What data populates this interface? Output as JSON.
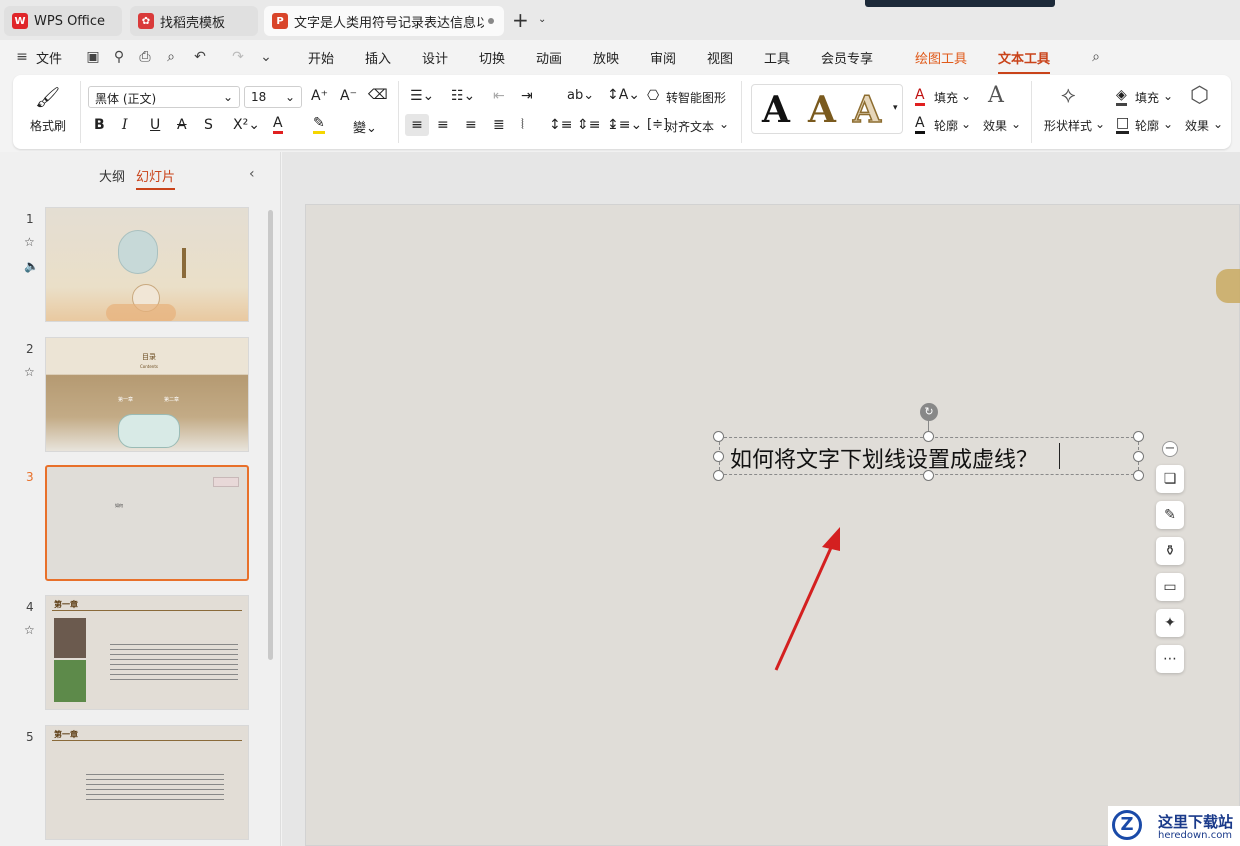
{
  "tabs": {
    "wps": "WPS Office",
    "template": "找稻壳模板",
    "document": "文字是人类用符号记录表达信息以"
  },
  "menu": {
    "file": "文件",
    "items": [
      "开始",
      "插入",
      "设计",
      "切换",
      "动画",
      "放映",
      "审阅",
      "视图",
      "工具",
      "会员专享"
    ],
    "drawing_tools": "绘图工具",
    "text_tools": "文本工具"
  },
  "ribbon": {
    "format_painter": "格式刷",
    "font_name": "黑体 (正文)",
    "font_size": "18",
    "smart_shape": "转智能图形",
    "align_text": "对齐文本",
    "fill": "填充",
    "outline": "轮廓",
    "effects": "效果",
    "shape_style": "形状样式",
    "fill2": "填充",
    "outline2": "轮廓",
    "effects2": "效果",
    "style_letters": [
      "A",
      "A",
      "A"
    ]
  },
  "panel": {
    "outline_tab": "大纲",
    "slides_tab": "幻灯片",
    "slide_numbers": [
      "1",
      "2",
      "3",
      "4",
      "5"
    ],
    "thumb2": {
      "title": "目录",
      "subtitle": "Contents",
      "left": "第一章",
      "right": "第二章"
    },
    "thumb4": {
      "title": "第一章"
    },
    "thumb5": {
      "title": "第一章"
    },
    "thumb3_text": "如何"
  },
  "slide": {
    "textbox": "如何将文字下划线设置成虚线？"
  },
  "watermark": {
    "name": "这里下载站",
    "url": "heredown.com"
  },
  "colors": {
    "accent": "#c9431a",
    "selection": "#e8702a",
    "arrow": "#d42020"
  }
}
